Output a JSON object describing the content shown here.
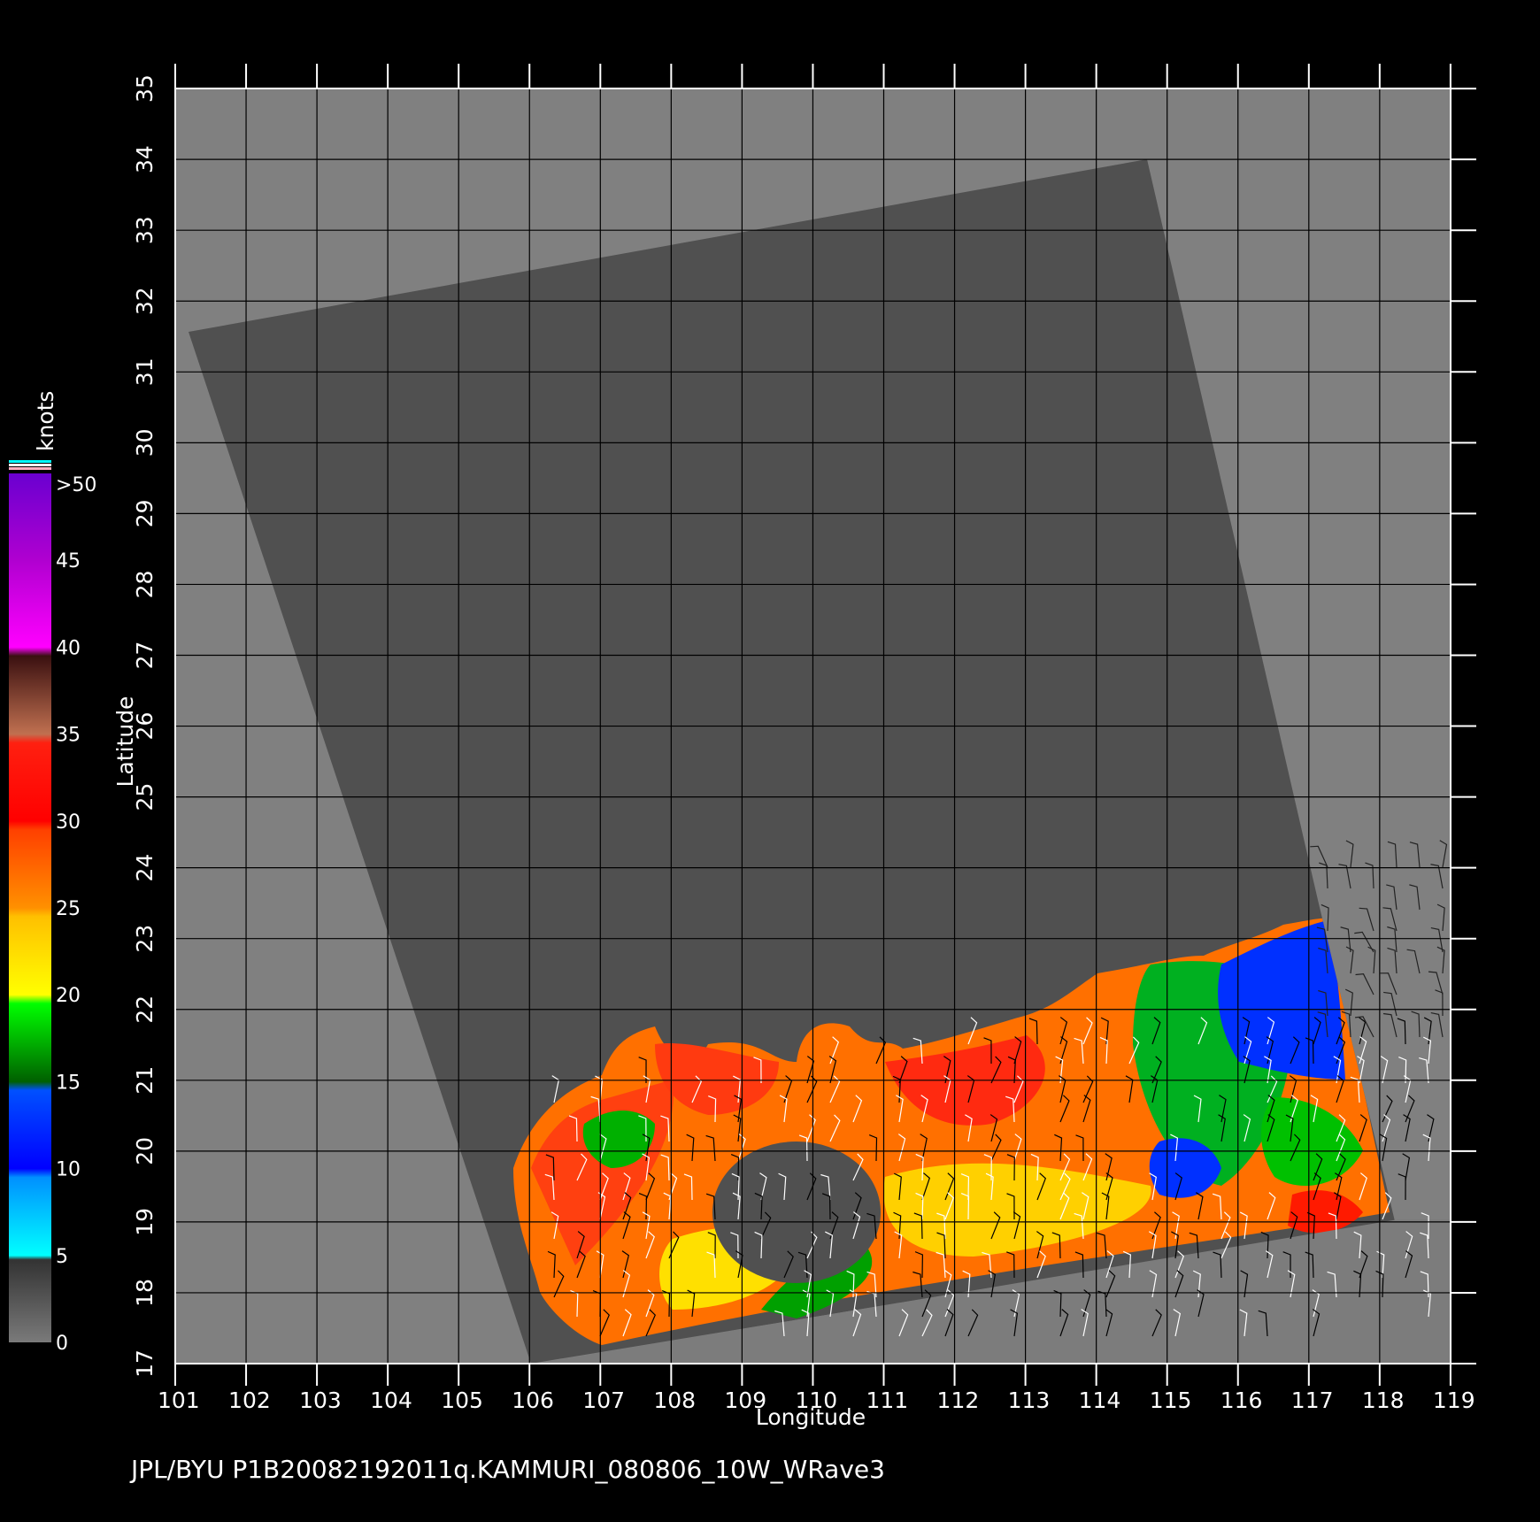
{
  "map": {
    "x_label": "Longitude",
    "y_label": "Latitude",
    "lon_ticks": [
      "101",
      "102",
      "103",
      "104",
      "105",
      "106",
      "107",
      "108",
      "109",
      "110",
      "111",
      "112",
      "113",
      "114",
      "115",
      "116",
      "117",
      "118",
      "119"
    ],
    "lat_ticks": [
      "17",
      "18",
      "19",
      "20",
      "21",
      "22",
      "23",
      "24",
      "25",
      "26",
      "27",
      "28",
      "29",
      "30",
      "31",
      "32",
      "33",
      "34",
      "35"
    ],
    "lon_range": [
      101,
      119
    ],
    "lat_range": [
      17,
      35
    ],
    "background_color": "#808080",
    "swath_color": "#505050",
    "grid_color": "#000000"
  },
  "colorbar": {
    "unit_label": "knots",
    "ticks": [
      "0",
      "5",
      "10",
      "15",
      "20",
      "25",
      "30",
      "35",
      "40",
      "45",
      ">50"
    ],
    "colors": {
      "0-5": "#3a3a3a",
      "5-10": "#00e8ff",
      "10-15": "#0030ff",
      "15-20": "#00a000",
      "20-25": "#ffd800",
      "25-30": "#ff7a00",
      "30-35": "#ff1a00",
      "35-40": "#8a4a3a",
      "40-45": "#ff00ff",
      "45-50": "#7a00d0"
    }
  },
  "footer": {
    "text": "JPL/BYU  P1B20082192011q.KAMMURI_080806_10W_WRave3"
  }
}
